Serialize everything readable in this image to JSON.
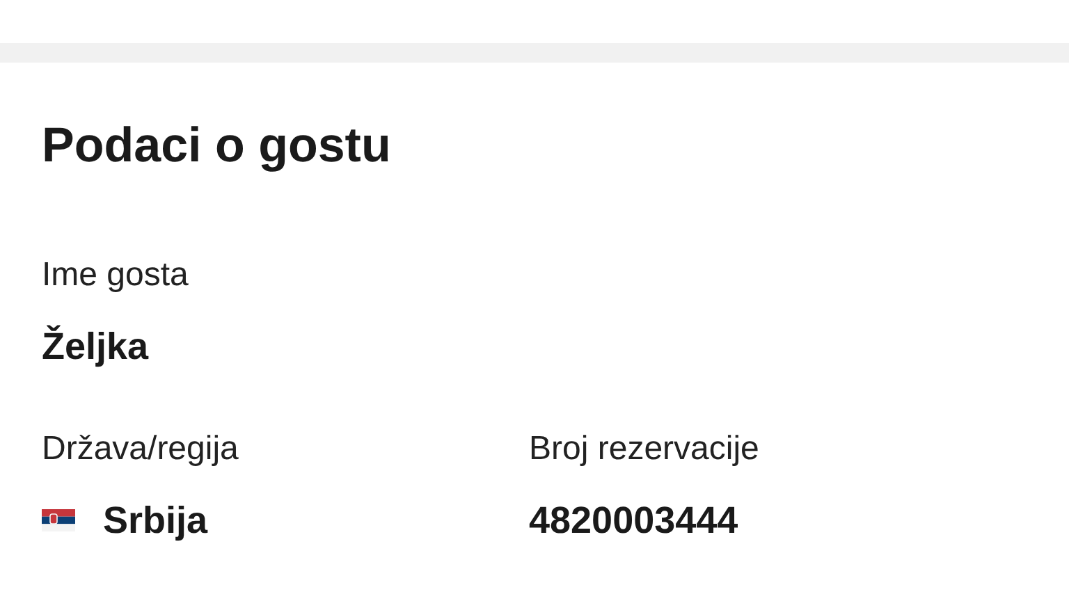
{
  "section": {
    "title": "Podaci o gostu"
  },
  "fields": [
    {
      "label": "Ime gosta",
      "value": "Željka",
      "flag": false
    },
    {
      "label": "Država/regija",
      "value": "Srbija",
      "flag": true
    },
    {
      "label": "Broj rezervacije",
      "value": "4820003444",
      "flag": false
    }
  ]
}
